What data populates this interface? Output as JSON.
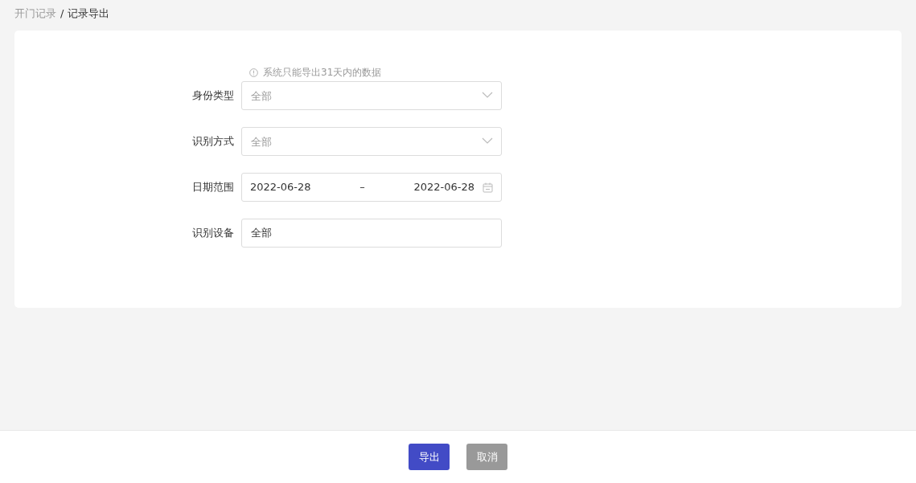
{
  "breadcrumb": [
    {
      "label": "开门记录",
      "current": false
    },
    {
      "label": "记录导出",
      "current": true
    }
  ],
  "breadcrumb_separator": "/",
  "notice": "系统只能导出31天内的数据",
  "fields": [
    {
      "kind": "select",
      "label": "身份类型",
      "placeholder": "全部"
    },
    {
      "kind": "select",
      "label": "识别方式",
      "placeholder": "全部"
    },
    {
      "kind": "date_range",
      "label": "日期范围",
      "start": "2022-06-28",
      "separator": "–",
      "end": "2022-06-28"
    },
    {
      "kind": "input",
      "label": "识别设备",
      "value": "全部"
    }
  ],
  "buttons": [
    {
      "label": "导出",
      "kind": "primary"
    },
    {
      "label": "取消",
      "kind": "secondary"
    }
  ]
}
